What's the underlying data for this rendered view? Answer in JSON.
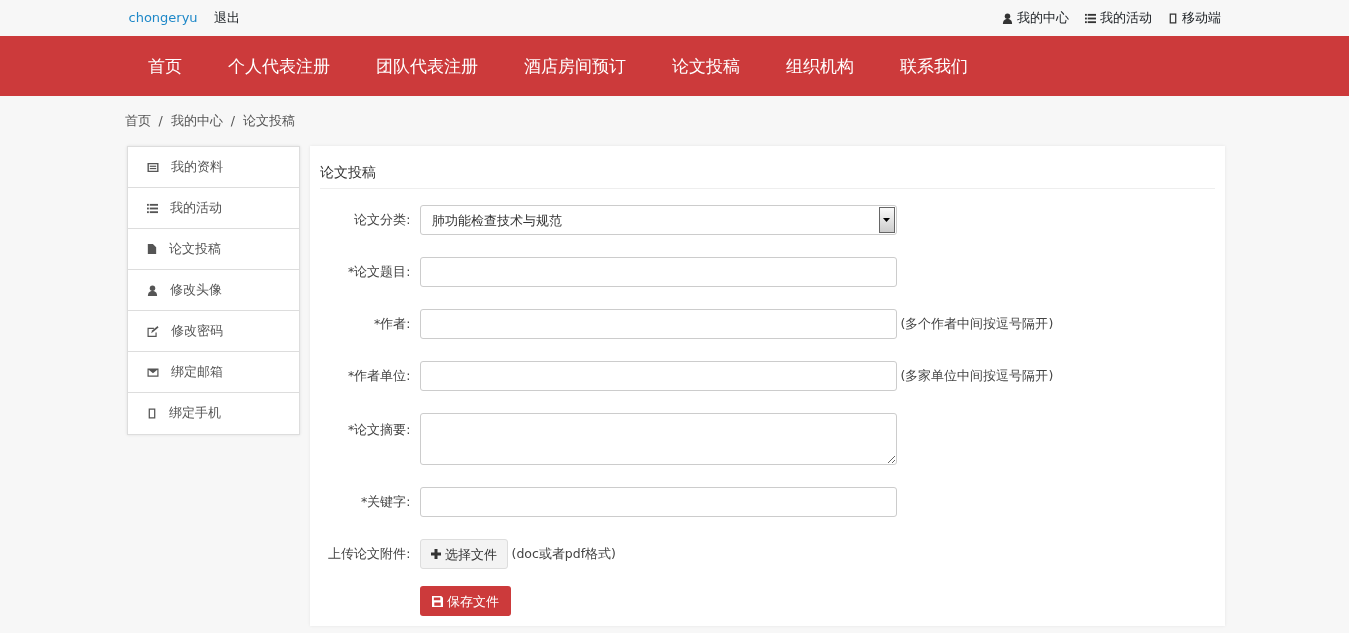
{
  "topbar": {
    "user": "chongeryu",
    "logout": "退出",
    "links": [
      {
        "label": "我的中心"
      },
      {
        "label": "我的活动"
      },
      {
        "label": "移动端"
      }
    ]
  },
  "nav": [
    "首页",
    "个人代表注册",
    "团队代表注册",
    "酒店房间预订",
    "论文投稿",
    "组织机构",
    "联系我们"
  ],
  "breadcrumb": [
    {
      "kind": "link",
      "text": "首页"
    },
    {
      "kind": "separator",
      "text": "/"
    },
    {
      "kind": "link",
      "text": "我的中心"
    },
    {
      "kind": "separator",
      "text": "/"
    },
    {
      "kind": "current",
      "text": "论文投稿"
    }
  ],
  "sidebar": [
    {
      "label": "我的资料"
    },
    {
      "label": "我的活动"
    },
    {
      "label": "论文投稿"
    },
    {
      "label": "修改头像"
    },
    {
      "label": "修改密码"
    },
    {
      "label": "绑定邮箱"
    },
    {
      "label": "绑定手机"
    }
  ],
  "panel_title": "论文投稿",
  "form": [
    {
      "kind": "select",
      "label": "论文分类:",
      "value": "肺功能检查技术与规范"
    },
    {
      "kind": "text",
      "label": "*论文题目:"
    },
    {
      "kind": "text",
      "label": "*作者:",
      "hint": "(多个作者中间按逗号隔开)"
    },
    {
      "kind": "text",
      "label": "*作者单位:",
      "hint": "(多家单位中间按逗号隔开)"
    },
    {
      "kind": "textarea",
      "label": "*论文摘要:"
    },
    {
      "kind": "text",
      "label": "*关键字:"
    },
    {
      "kind": "file",
      "label": "上传论文附件:",
      "button": "选择文件",
      "hint": "(doc或者pdf格式)"
    }
  ],
  "save_button": "保存文件"
}
